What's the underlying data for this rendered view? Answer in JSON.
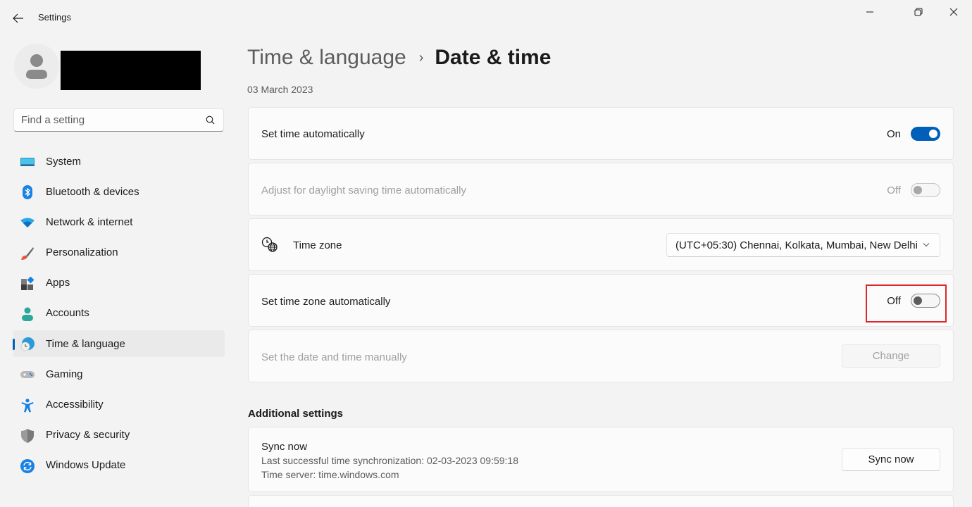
{
  "window": {
    "title": "Settings",
    "controls": {
      "minimize": "minimize-icon",
      "maximize": "restore-icon",
      "close": "close-icon"
    }
  },
  "sidebar": {
    "search_placeholder": "Find a setting",
    "items": [
      {
        "label": "System",
        "icon": "system-icon",
        "active": false
      },
      {
        "label": "Bluetooth & devices",
        "icon": "bluetooth-icon",
        "active": false
      },
      {
        "label": "Network & internet",
        "icon": "wifi-icon",
        "active": false
      },
      {
        "label": "Personalization",
        "icon": "paintbrush-icon",
        "active": false
      },
      {
        "label": "Apps",
        "icon": "apps-icon",
        "active": false
      },
      {
        "label": "Accounts",
        "icon": "accounts-icon",
        "active": false
      },
      {
        "label": "Time & language",
        "icon": "time-language-icon",
        "active": true
      },
      {
        "label": "Gaming",
        "icon": "gamepad-icon",
        "active": false
      },
      {
        "label": "Accessibility",
        "icon": "accessibility-icon",
        "active": false
      },
      {
        "label": "Privacy & security",
        "icon": "shield-icon",
        "active": false
      },
      {
        "label": "Windows Update",
        "icon": "update-icon",
        "active": false
      }
    ]
  },
  "header": {
    "breadcrumb_parent": "Time & language",
    "breadcrumb_separator": "›",
    "page_title": "Date & time",
    "current_date": "03 March 2023"
  },
  "settings": {
    "set_time_auto": {
      "label": "Set time automatically",
      "state": "On"
    },
    "daylight_saving": {
      "label": "Adjust for daylight saving time automatically",
      "state": "Off"
    },
    "time_zone": {
      "label": "Time zone",
      "value": "(UTC+05:30) Chennai, Kolkata, Mumbai, New Delhi"
    },
    "set_tz_auto": {
      "label": "Set time zone automatically",
      "state": "Off"
    },
    "manual": {
      "label": "Set the date and time manually",
      "button": "Change"
    }
  },
  "additional": {
    "section_title": "Additional settings",
    "sync": {
      "title": "Sync now",
      "last_sync": "Last successful time synchronization: 02-03-2023 09:59:18",
      "server": "Time server: time.windows.com",
      "button": "Sync now"
    }
  },
  "colors": {
    "accent": "#005fb8",
    "highlight": "#e0262b"
  }
}
